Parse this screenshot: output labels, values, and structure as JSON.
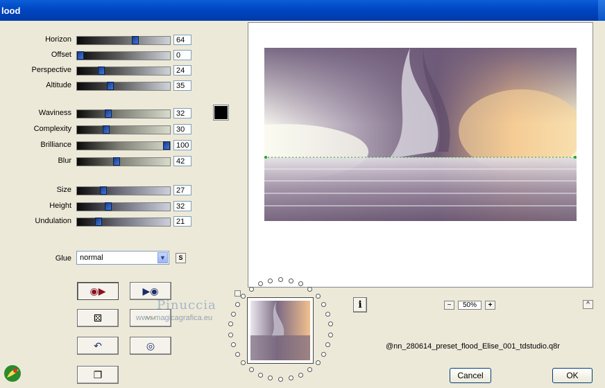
{
  "window": {
    "title": "lood"
  },
  "sliders": [
    {
      "label": "Horizon",
      "value": "64",
      "pos": 0.64,
      "style": "t1"
    },
    {
      "label": "Offset",
      "value": "0",
      "pos": 0.0,
      "style": "t1"
    },
    {
      "label": "Perspective",
      "value": "24",
      "pos": 0.24,
      "style": "t1"
    },
    {
      "label": "Altitude",
      "value": "35",
      "pos": 0.35,
      "style": "t1"
    },
    {
      "label": "Waviness",
      "value": "32",
      "pos": 0.32,
      "style": "t2"
    },
    {
      "label": "Complexity",
      "value": "30",
      "pos": 0.3,
      "style": "t2"
    },
    {
      "label": "Brilliance",
      "value": "100",
      "pos": 1.0,
      "style": "t2"
    },
    {
      "label": "Blur",
      "value": "42",
      "pos": 0.42,
      "style": "t2"
    },
    {
      "label": "Size",
      "value": "27",
      "pos": 0.27,
      "style": "t3"
    },
    {
      "label": "Height",
      "value": "32",
      "pos": 0.32,
      "style": "t3"
    },
    {
      "label": "Undulation",
      "value": "21",
      "pos": 0.21,
      "style": "t3"
    }
  ],
  "color_swatch": "#000000",
  "glue": {
    "label": "Glue",
    "value": "normal",
    "s_label": "S"
  },
  "zoom": {
    "minus": "−",
    "value": "50%",
    "plus": "+"
  },
  "info_button": "i",
  "expand_button": "^",
  "preset_filename": "@nn_280614_preset_flood_Elise_001_tdstudio.q8r",
  "buttons": {
    "cancel": "Cancel",
    "ok": "OK"
  },
  "watermark": {
    "line1": "Pinuccia",
    "line2": "www.magicagrafica.eu"
  },
  "icons": [
    "play-right-icon",
    "play-left-icon",
    "dice-icon",
    "brush-icon",
    "undo-icon",
    "reset-circle-icon",
    "copy-icon",
    "app-logo-icon"
  ]
}
